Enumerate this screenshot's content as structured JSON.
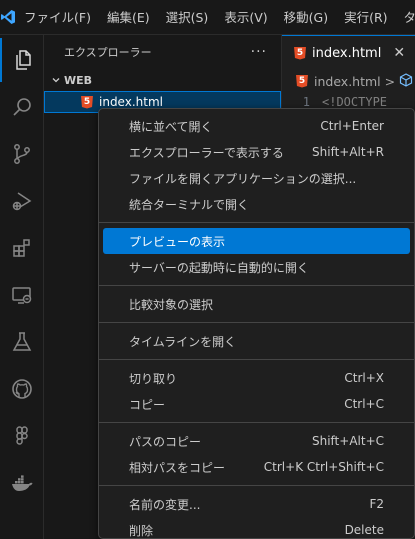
{
  "menu_bar": [
    "ファイル(F)",
    "編集(E)",
    "選択(S)",
    "表示(V)",
    "移動(G)",
    "実行(R)",
    "ター"
  ],
  "activity_icons": [
    "explorer-icon",
    "search-icon",
    "source-control-icon",
    "run-debug-icon",
    "extensions-icon",
    "remote-explorer-icon",
    "testing-icon",
    "github-icon",
    "figma-icon",
    "docker-icon"
  ],
  "sidebar": {
    "title": "エクスプローラー",
    "more": "···",
    "section": "WEB",
    "file": "index.html"
  },
  "editor": {
    "tab_label": "index.html",
    "tab_close": "✕",
    "breadcrumb_file": "index.html",
    "breadcrumb_sep": ">",
    "line_number": "1",
    "code_text": "<!DOCTYPE"
  },
  "context_menu": {
    "groups": [
      [
        {
          "label": "横に並べて開く",
          "shortcut": "Ctrl+Enter"
        },
        {
          "label": "エクスプローラーで表示する",
          "shortcut": "Shift+Alt+R"
        },
        {
          "label": "ファイルを開くアプリケーションの選択...",
          "shortcut": ""
        },
        {
          "label": "統合ターミナルで開く",
          "shortcut": ""
        }
      ],
      [
        {
          "label": "プレビューの表示",
          "shortcut": "",
          "selected": true
        },
        {
          "label": "サーバーの起動時に自動的に開く",
          "shortcut": ""
        }
      ],
      [
        {
          "label": "比較対象の選択",
          "shortcut": ""
        }
      ],
      [
        {
          "label": "タイムラインを開く",
          "shortcut": ""
        }
      ],
      [
        {
          "label": "切り取り",
          "shortcut": "Ctrl+X"
        },
        {
          "label": "コピー",
          "shortcut": "Ctrl+C"
        }
      ],
      [
        {
          "label": "パスのコピー",
          "shortcut": "Shift+Alt+C"
        },
        {
          "label": "相対パスをコピー",
          "shortcut": "Ctrl+K Ctrl+Shift+C"
        }
      ],
      [
        {
          "label": "名前の変更...",
          "shortcut": "F2"
        },
        {
          "label": "削除",
          "shortcut": "Delete"
        }
      ]
    ]
  },
  "colors": {
    "accent": "#0078d4",
    "background": "#1f1f1f",
    "html_icon": "#e44d26"
  }
}
